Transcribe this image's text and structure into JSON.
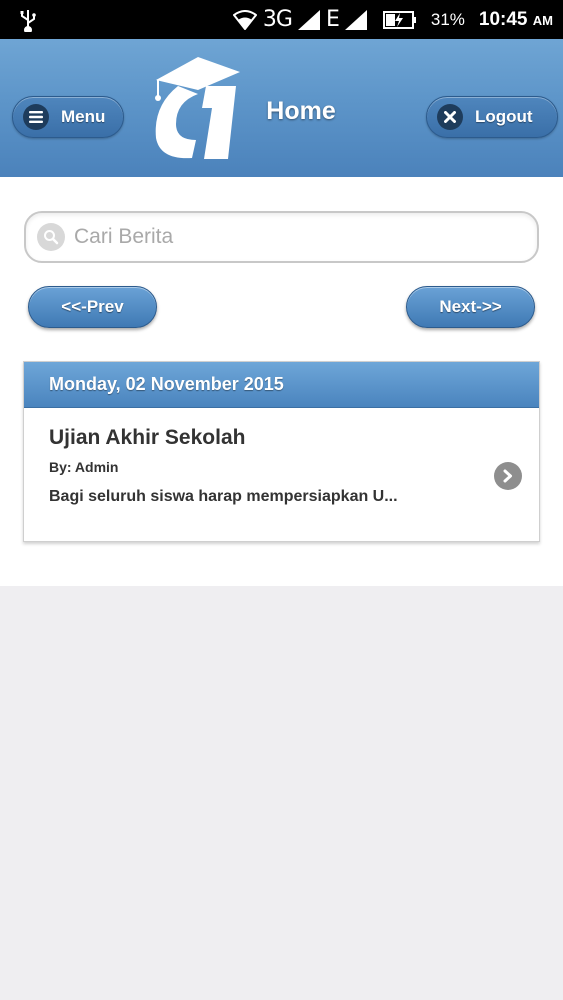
{
  "status_bar": {
    "network": "3G",
    "network2": "E",
    "battery": "31%",
    "time": "10:45",
    "ampm": "AM"
  },
  "header": {
    "title": "Home",
    "menu_label": "Menu",
    "logout_label": "Logout"
  },
  "search": {
    "placeholder": "Cari Berita",
    "value": ""
  },
  "pagination": {
    "prev_label": "<<-Prev",
    "next_label": "Next->>"
  },
  "news": {
    "date": "Monday, 02 November 2015",
    "items": [
      {
        "title": "Ujian Akhir Sekolah",
        "author": "By: Admin",
        "summary": "Bagi seluruh siswa harap mempersiapkan U..."
      }
    ]
  },
  "colors": {
    "header": "#5d95c9",
    "accent": "#4a84be",
    "background": "#efeef1"
  }
}
